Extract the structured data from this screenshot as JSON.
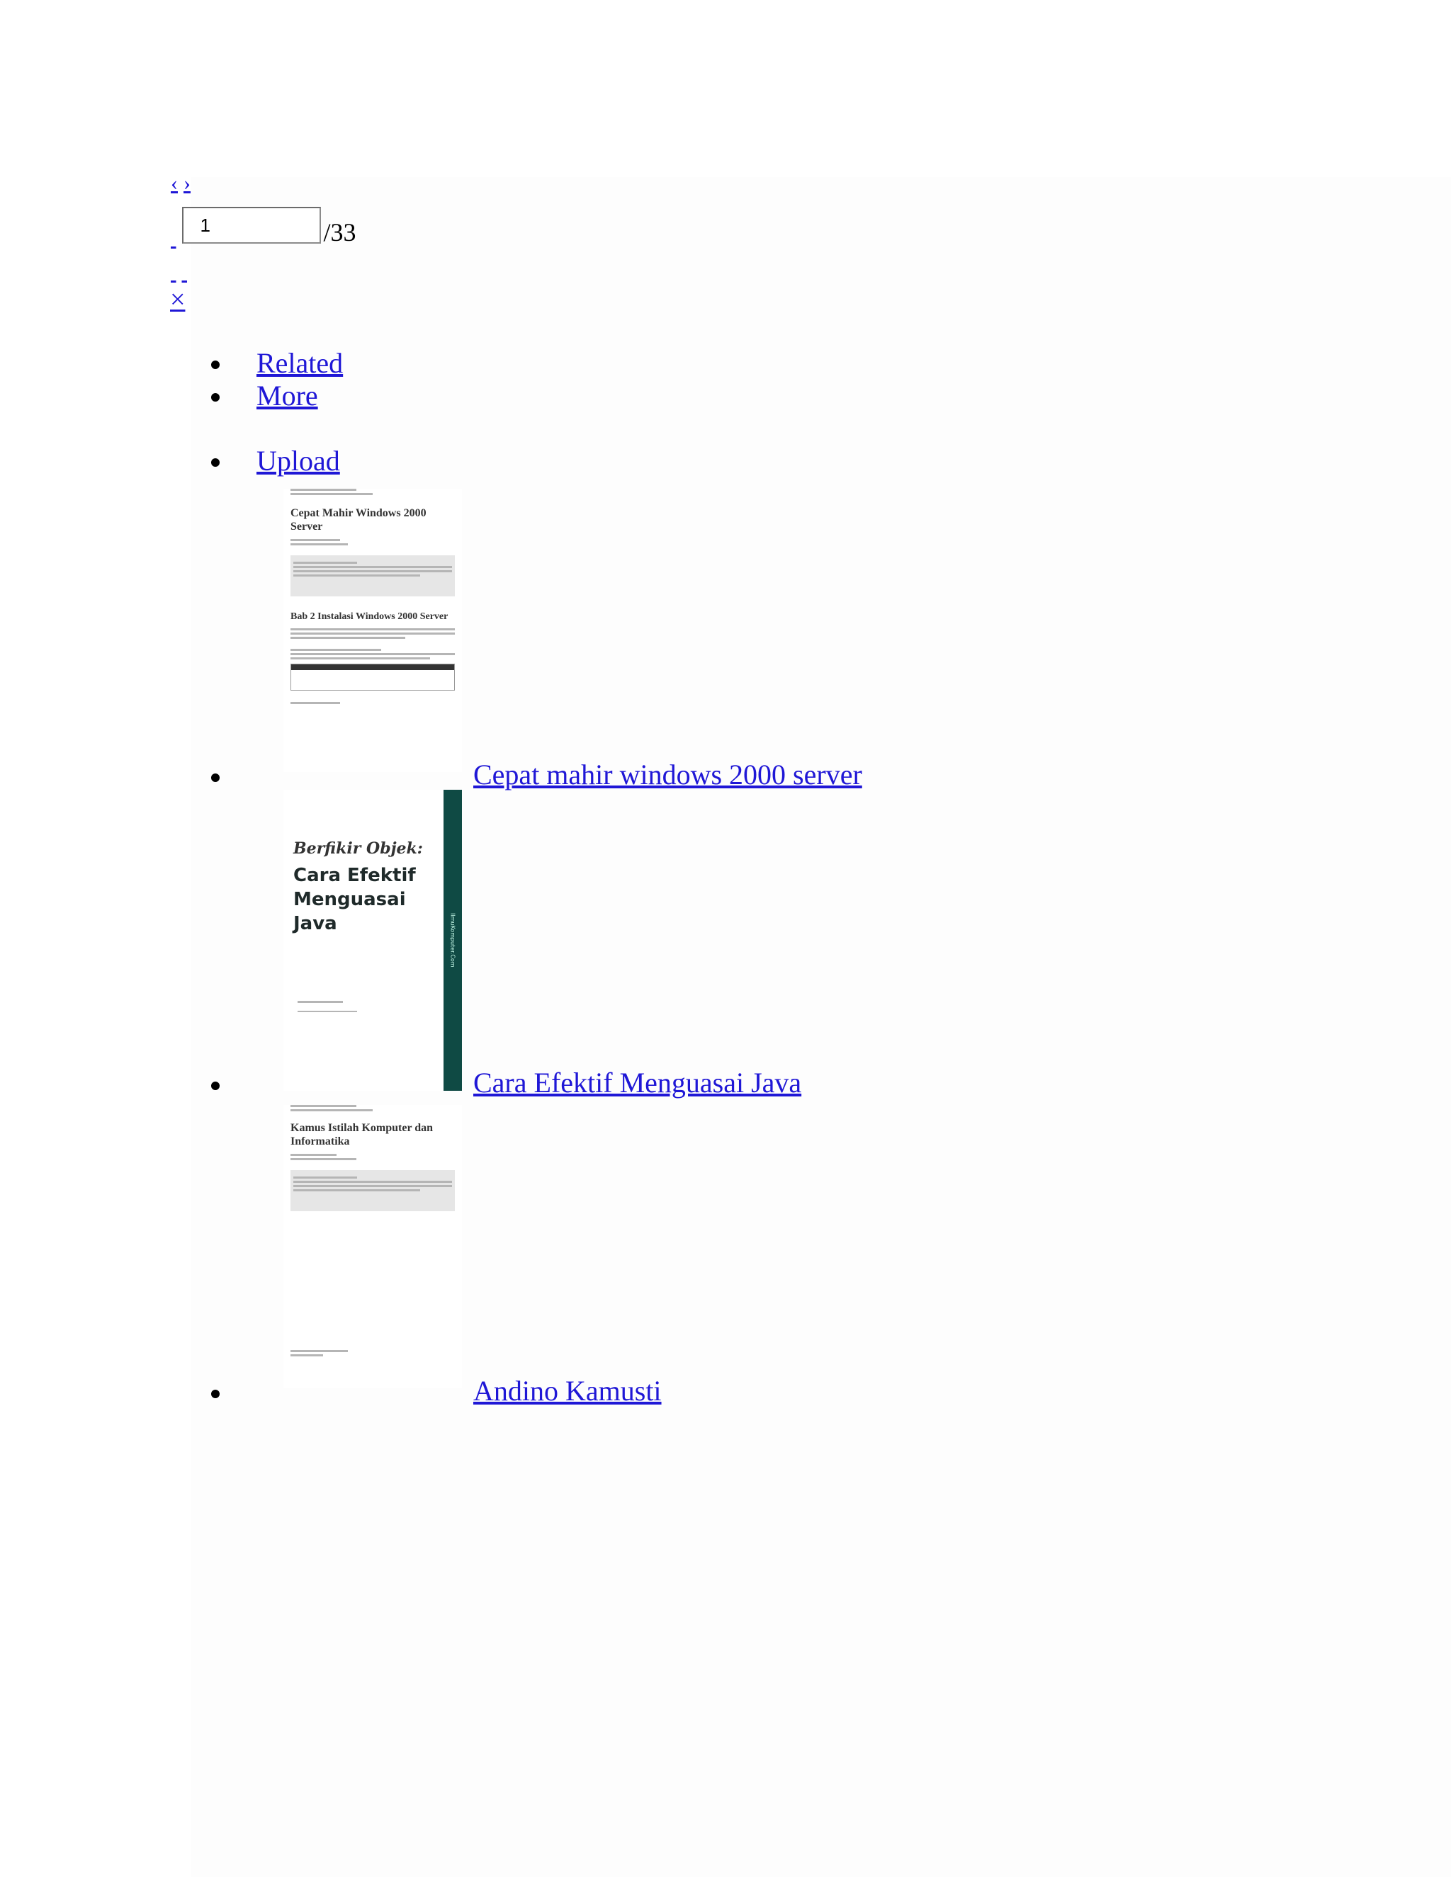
{
  "viewer": {
    "prev_label": "‹",
    "next_label": "›",
    "page_value": "1",
    "page_total": "/33",
    "close_label": "×"
  },
  "menu": {
    "items": [
      {
        "label": "Related"
      },
      {
        "label": "More"
      },
      {
        "label": "Upload"
      }
    ]
  },
  "related_docs": [
    {
      "title": "Cepat mahir windows 2000 server",
      "thumb_heading": "Cepat Mahir Windows 2000 Server",
      "thumb_subheading": "Bab 2 Instalasi Windows 2000 Server"
    },
    {
      "title": "Cara Efektif Menguasai Java",
      "thumb_heading_1": "Berfikir Objek:",
      "thumb_heading_2": "Cara Efektif Menguasai Java",
      "thumb_spine": "IlmuKomputer.Com",
      "spine_color": "#0f4a44"
    },
    {
      "title": "Andino Kamusti",
      "thumb_heading": "Kamus Istilah Komputer dan Informatika"
    }
  ]
}
